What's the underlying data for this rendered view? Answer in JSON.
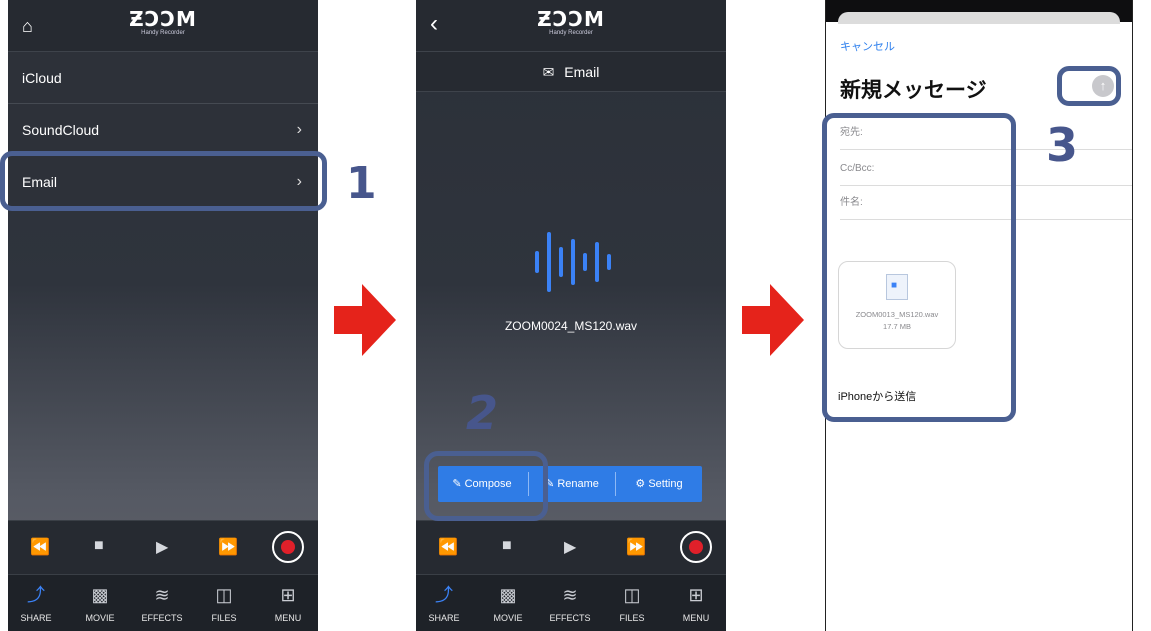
{
  "screen1": {
    "brand": "ƵƆƆM",
    "brand_sub": "Handy Recorder",
    "home_icon": "home-icon",
    "rows": [
      {
        "label": "iCloud"
      },
      {
        "label": "SoundCloud"
      },
      {
        "label": "Email"
      }
    ],
    "step_number": "1"
  },
  "screen2": {
    "brand": "ƵƆƆM",
    "brand_sub": "Handy Recorder",
    "back_icon": "chevron-left-icon",
    "email_title": "Email",
    "filename": "ZOOM0024_MS120.wav",
    "actions": {
      "compose": "Compose",
      "rename": "Rename",
      "setting": "Setting"
    },
    "step_number": "2"
  },
  "tabbar": {
    "tabs": [
      {
        "label": "SHARE",
        "icon": "share-icon"
      },
      {
        "label": "MOVIE",
        "icon": "movie-icon"
      },
      {
        "label": "EFFECTS",
        "icon": "effects-icon"
      },
      {
        "label": "FILES",
        "icon": "files-icon"
      },
      {
        "label": "MENU",
        "icon": "menu-icon"
      }
    ]
  },
  "screen3": {
    "cancel": "キャンセル",
    "title": "新規メッセージ",
    "fields": {
      "to": "宛先:",
      "cc": "Cc/Bcc:",
      "subject": "件名:"
    },
    "attachment": {
      "name": "ZOOM0013_MS120.wav",
      "size": "17.7 MB"
    },
    "signature": "iPhoneから送信",
    "step_number": "3"
  },
  "colors": {
    "accent": "#3b82f6",
    "highlight": "#4a5f91",
    "arrow": "#e5231b",
    "record": "#e0202a"
  }
}
